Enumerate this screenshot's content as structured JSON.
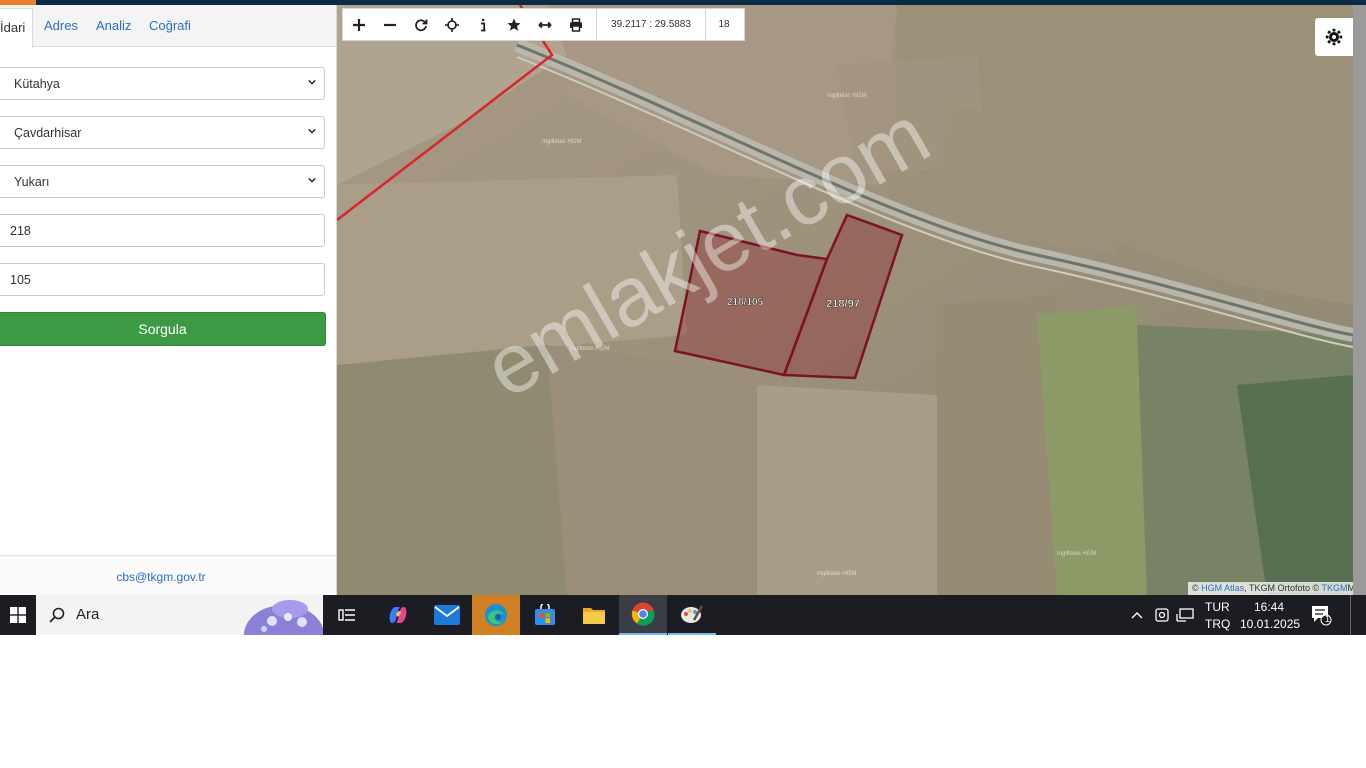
{
  "tabs": [
    {
      "label": "İdari",
      "active": true
    },
    {
      "label": "Adres"
    },
    {
      "label": "Analiz"
    },
    {
      "label": "Coğrafi"
    }
  ],
  "form": {
    "il": "Kütahya",
    "ilce": "Çavdarhisar",
    "mahalle": "Yukarı",
    "ada": "218",
    "parsel": "105",
    "submit_label": "Sorgula"
  },
  "footer": {
    "email": "cbs@tkgm.gov.tr"
  },
  "toolbar": {
    "coordinates": "39.2117 : 29.5883",
    "zoom": "18"
  },
  "map": {
    "parcel_labels": [
      "218/105",
      "218/97"
    ],
    "watermark": "emlakjet.com",
    "field_labels": [
      "Ingiltelas HGM"
    ],
    "attribution": {
      "prefix": "©",
      "hgm_atlas": "HGM Atlas",
      "middle": ", TKGM Ortofoto ©",
      "tkgm": "TKGM",
      "tail": "M"
    }
  },
  "taskbar": {
    "search_label": "Ara",
    "lang_top": "TUR",
    "lang_bottom": "TRQ",
    "time": "16:44",
    "date": "10.01.2025",
    "notifications": "1"
  },
  "colors": {
    "accent_green": "#3d9a44",
    "link_blue": "#2a6fbf",
    "parcel_outline": "#7a1228",
    "boundary_red": "#d8262b"
  }
}
